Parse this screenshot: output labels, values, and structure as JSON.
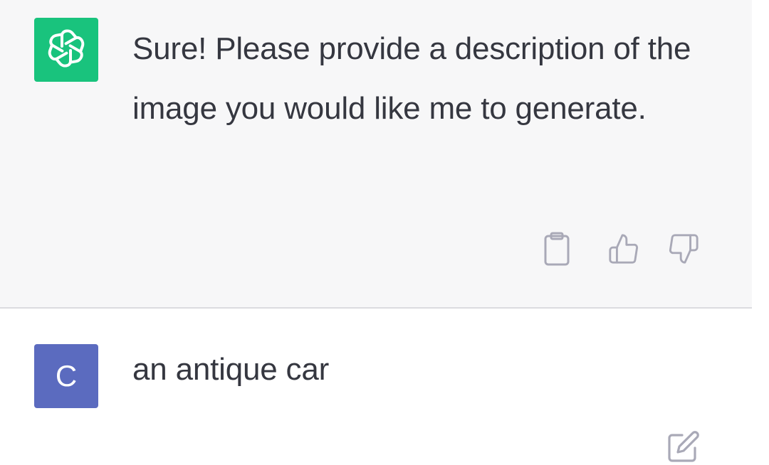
{
  "assistant": {
    "avatar_icon": "openai-logo-icon",
    "avatar_color": "#19c37d",
    "message": "Sure! Please provide a description of the image you would like me to generate."
  },
  "actions": {
    "copy_icon": "clipboard-icon",
    "like_icon": "thumbs-up-icon",
    "dislike_icon": "thumbs-down-icon"
  },
  "user": {
    "avatar_letter": "C",
    "avatar_color": "#5b6bbf",
    "message": "an antique car",
    "edit_icon": "edit-icon"
  }
}
